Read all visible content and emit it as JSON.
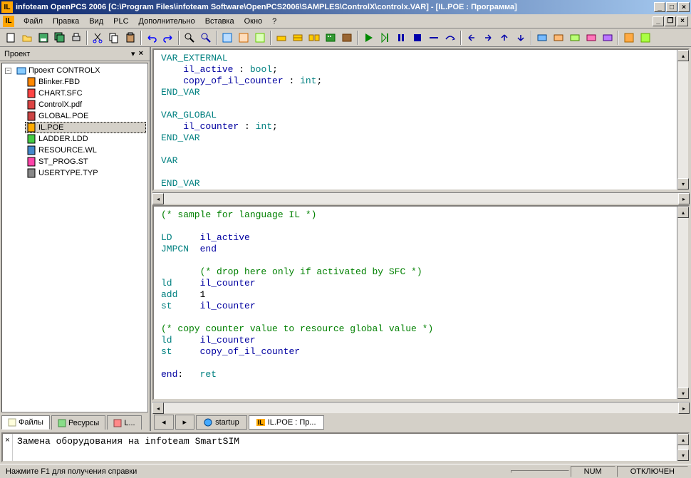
{
  "title": "infoteam OpenPCS 2006 [C:\\Program Files\\infoteam Software\\OpenPCS2006\\SAMPLES\\ControlX\\controlx.VAR]  - [IL.POE : Программа]",
  "app_icon_text": "IL",
  "menu": [
    "Файл",
    "Правка",
    "Вид",
    "PLC",
    "Дополнительно",
    "Вставка",
    "Окно",
    "?"
  ],
  "project_panel": {
    "title": "Проект",
    "root": "Проект CONTROLX",
    "items": [
      "Blinker.FBD",
      "CHART.SFC",
      "ControlX.pdf",
      "GLOBAL.POE",
      "IL.POE",
      "LADDER.LDD",
      "RESOURCE.WL",
      "ST_PROG.ST",
      "USERTYPE.TYP"
    ],
    "selected_index": 4,
    "tabs": [
      "Файлы",
      "Ресурсы",
      "L..."
    ]
  },
  "editor": {
    "top_code_html": "<span class='kw'>VAR_EXTERNAL</span>\n    <span class='ident'>il_active</span> : <span class='kw'>bool</span>;\n    <span class='ident'>copy_of_il_counter</span> : <span class='kw'>int</span>;\n<span class='kw'>END_VAR</span>\n\n<span class='kw'>VAR_GLOBAL</span>\n    <span class='ident'>il_counter</span> : <span class='kw'>int</span>;\n<span class='kw'>END_VAR</span>\n\n<span class='kw'>VAR</span>\n\n<span class='kw'>END_VAR</span>",
    "bottom_code_html": "<span class='comment'>(* sample for language IL *)</span>\n\n<span class='kw'>LD</span>     <span class='ident'>il_active</span>\n<span class='kw'>JMPCN</span>  <span class='ident'>end</span>\n\n       <span class='comment'>(* drop here only if activated by SFC *)</span>\n<span class='kw'>ld</span>     <span class='ident'>il_counter</span>\n<span class='kw'>add</span>    <span class='num'>1</span>\n<span class='kw'>st</span>     <span class='ident'>il_counter</span>\n\n<span class='comment'>(* copy counter value to resource global value *)</span>\n<span class='kw'>ld</span>     <span class='ident'>il_counter</span>\n<span class='kw'>st</span>     <span class='ident'>copy_of_il_counter</span>\n\n<span class='ident'>end</span>:   <span class='kw'>ret</span>",
    "tabs": [
      {
        "label": "startup",
        "active": false
      },
      {
        "label": "IL.POE : Пр...",
        "active": true,
        "icon": "IL"
      }
    ]
  },
  "output": {
    "text": "Замена оборудования на infoteam SmartSIM"
  },
  "statusbar": {
    "help": "Нажмите F1 для получения справки",
    "num": "NUM",
    "conn": "ОТКЛЮЧЕН"
  }
}
